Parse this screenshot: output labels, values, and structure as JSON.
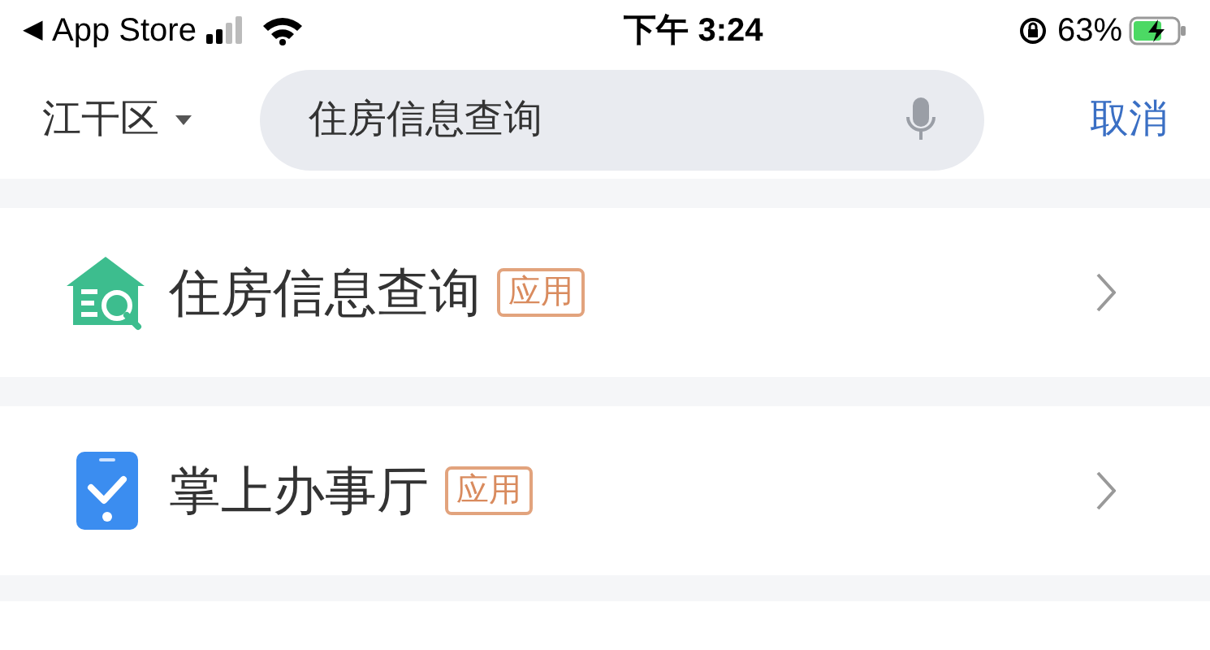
{
  "status_bar": {
    "back_arrow": "◀",
    "back_label": "App Store",
    "time": "下午 3:24",
    "battery": "63%"
  },
  "search_header": {
    "district": "江干区",
    "query": "住房信息查询",
    "cancel": "取消"
  },
  "results": [
    {
      "kind": "house",
      "title": "住房信息查询",
      "tag": "应用"
    },
    {
      "kind": "phone",
      "title": "掌上办事厅",
      "tag": "应用"
    }
  ]
}
